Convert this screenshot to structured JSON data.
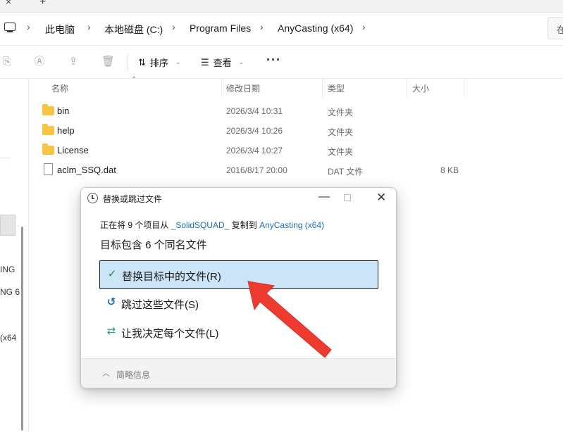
{
  "breadcrumb": {
    "items": [
      "此电脑",
      "本地磁盘 (C:)",
      "Program Files",
      "AnyCasting (x64)"
    ],
    "search_text": "在"
  },
  "toolbar": {
    "sort_label": "排序",
    "view_label": "查看",
    "more_label": "···"
  },
  "nav_pane": {
    "partial_texts": [
      "ING",
      "NG 6",
      "(x64"
    ]
  },
  "columns": {
    "name": "名称",
    "date": "修改日期",
    "type": "类型",
    "size": "大小"
  },
  "files": [
    {
      "name": "bin",
      "date": "2026/3/4 10:31",
      "type": "文件夹",
      "size": "",
      "kind": "folder"
    },
    {
      "name": "help",
      "date": "2026/3/4 10:26",
      "type": "文件夹",
      "size": "",
      "kind": "folder"
    },
    {
      "name": "License",
      "date": "2026/3/4 10:27",
      "type": "文件夹",
      "size": "",
      "kind": "folder"
    },
    {
      "name": "aclm_SSQ.dat",
      "date": "2016/8/17 20:00",
      "type": "DAT 文件",
      "size": "8 KB",
      "kind": "file"
    }
  ],
  "dialog": {
    "title": "替换或跳过文件",
    "progress_prefix": "正在将 9 个项目从 ",
    "source": "_SolidSQUAD_",
    "progress_middle": " 复制到 ",
    "destination": "AnyCasting (x64)",
    "conflict_message": "目标包含 6 个同名文件",
    "options": [
      {
        "label": "替换目标中的文件(R)",
        "icon": "check-icon",
        "selected": true
      },
      {
        "label": "跳过这些文件(S)",
        "icon": "skip-icon",
        "selected": false
      },
      {
        "label": "让我决定每个文件(L)",
        "icon": "decide-icon",
        "selected": false
      }
    ],
    "details_label": "简略信息"
  },
  "colors": {
    "accent": "#1a6fb0",
    "selection": "#cce4f7",
    "folder": "#f8c443",
    "annotation_arrow": "#ee3b30"
  }
}
